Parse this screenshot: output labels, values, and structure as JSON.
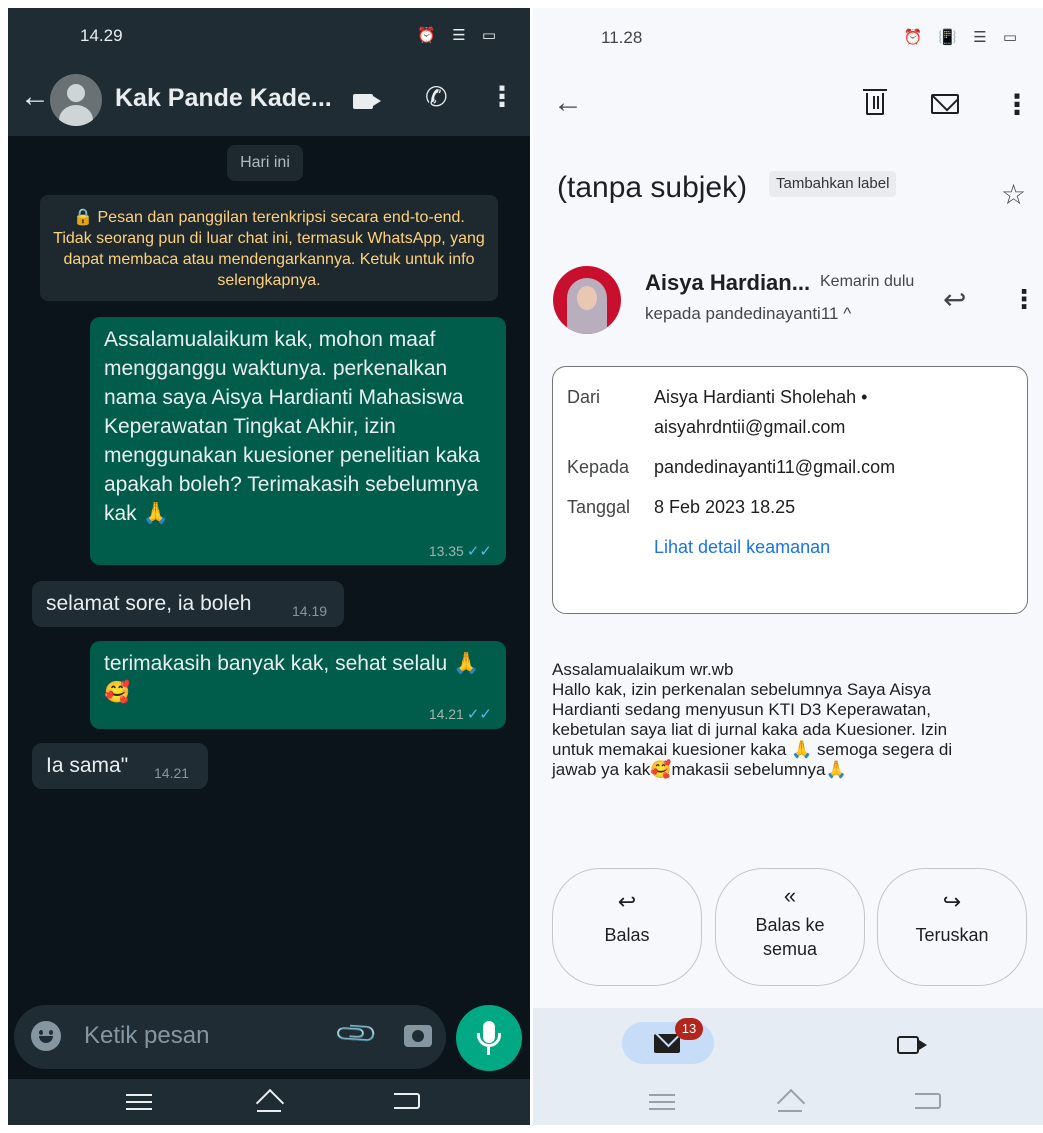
{
  "whatsapp": {
    "status_time": "14.29",
    "status_icons": "⏰ ☰ ▭",
    "contact_name": "Kak Pande Kade...",
    "date_chip": "Hari ini",
    "encryption_notice": "🔒 Pesan dan panggilan terenkripsi secara end-to-end. Tidak seorang pun di luar chat ini, termasuk WhatsApp, yang dapat membaca atau mendengarkannya. Ketuk untuk info selengkapnya.",
    "messages": [
      {
        "direction": "out",
        "text": "Assalamualaikum kak, mohon maaf mengganggu waktunya. perkenalkan nama saya Aisya Hardianti Mahasiswa Keperawatan Tingkat Akhir, izin menggunakan kuesioner penelitian kaka apakah boleh? Terimakasih sebelumnya kak 🙏",
        "time": "13.35",
        "ticks": "✓✓"
      },
      {
        "direction": "in",
        "text": "selamat sore, ia boleh",
        "time": "14.19"
      },
      {
        "direction": "out",
        "text": "terimakasih banyak kak, sehat selalu 🙏🥰",
        "time": "14.21",
        "ticks": "✓✓"
      },
      {
        "direction": "in",
        "text": "Ia sama\"",
        "time": "14.21"
      }
    ],
    "input_placeholder": "Ketik pesan"
  },
  "gmail": {
    "status_time": "11.28",
    "status_icons": "⏰ 📳 ☰ ▭",
    "subject": "(tanpa subjek)",
    "label_chip": "Tambahkan label",
    "sender_name": "Aisya Hardian...",
    "sent_when": "Kemarin dulu",
    "to_line": "kepada pandedinayanti11 ^",
    "details": {
      "from_label": "Dari",
      "from_name": "Aisya Hardianti Sholehah •",
      "from_email": "aisyahrdntii@gmail.com",
      "to_label": "Kepada",
      "to_value": "pandedinayanti11@gmail.com",
      "date_label": "Tanggal",
      "date_value": "8 Feb 2023 18.25",
      "security_link": "Lihat detail keamanan"
    },
    "body_lines": [
      "Assalamualaikum wr.wb",
      "Hallo kak, izin perkenalan sebelumnya Saya Aisya",
      "Hardianti sedang menyusun KTI D3 Keperawatan,",
      "kebetulan saya liat di jurnal  kaka ada Kuesioner. Izin",
      "untuk memakai kuesioner kaka 🙏 semoga segera di",
      "jawab ya kak🥰makasii sebelumnya🙏"
    ],
    "actions": {
      "reply": "Balas",
      "reply_all": "Balas ke semua",
      "forward": "Teruskan"
    },
    "unread_badge": "13"
  }
}
